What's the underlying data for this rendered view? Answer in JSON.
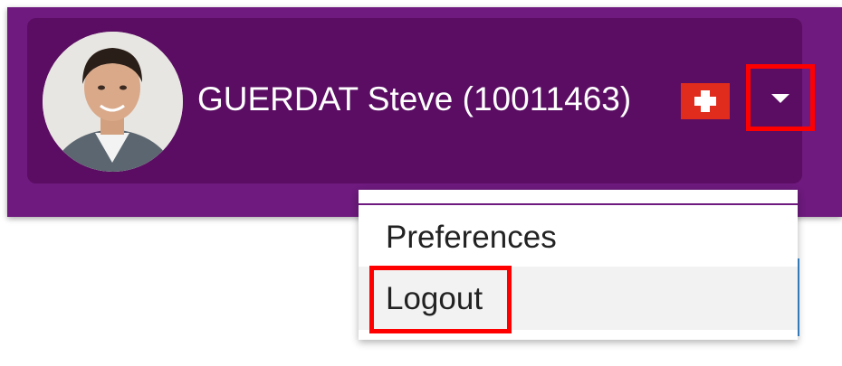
{
  "header": {
    "user_name": "GUERDAT Steve (10011463)",
    "avatar_icon": "user-photo-icon",
    "flag_icon": "swiss-flag-icon",
    "dropdown_icon": "caret-down-icon",
    "colors": {
      "topbar": "#6e1a7e",
      "panel": "#5a0d62",
      "highlight": "#ff0000"
    }
  },
  "user_menu": {
    "items": [
      {
        "label": "Preferences"
      },
      {
        "label": "Logout"
      }
    ]
  }
}
